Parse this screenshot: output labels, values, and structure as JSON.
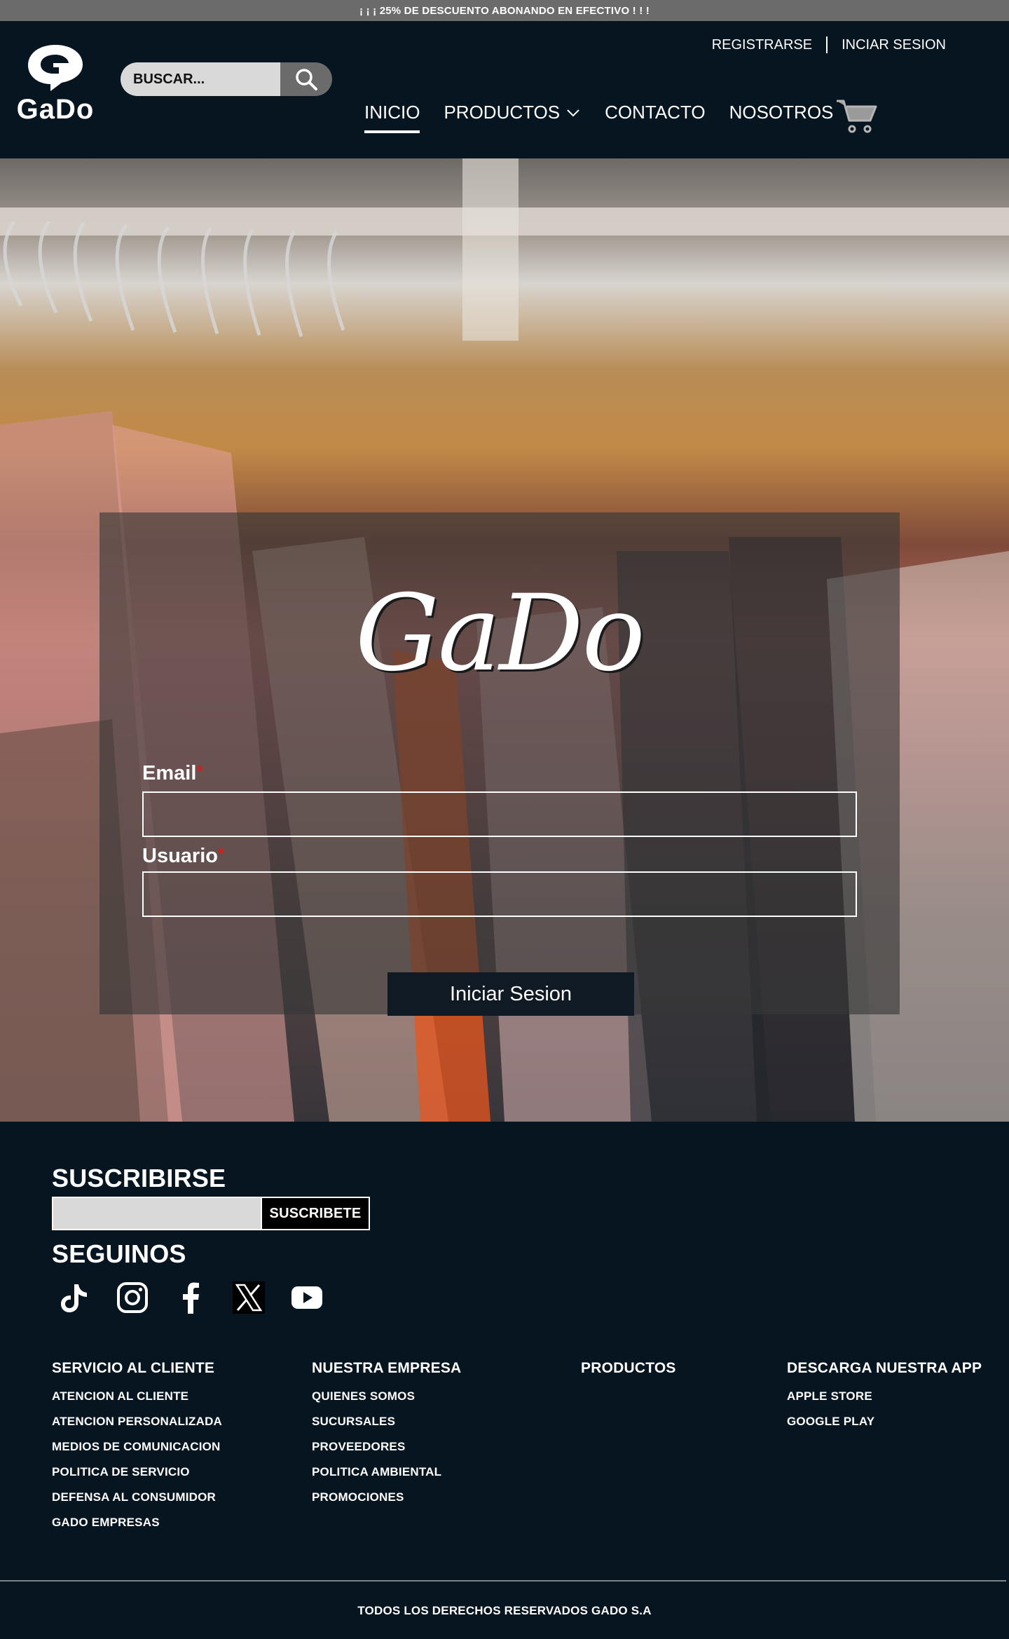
{
  "promo": {
    "text": "¡ ¡ ¡ 25% DE DESCUENTO ABONANDO EN EFECTIVO ! ! !"
  },
  "header": {
    "logo_text": "GaDo",
    "search": {
      "placeholder": "BUSCAR..."
    },
    "account": {
      "register": "REGISTRARSE",
      "login": "INCIAR SESION"
    },
    "nav": {
      "inicio": "INICIO",
      "productos": "PRODUCTOS",
      "contacto": "CONTACTO",
      "nosotros": "NOSOTROS"
    }
  },
  "login": {
    "brand": "GaDo",
    "email_label": "Email",
    "usuario_label": "Usuario",
    "required_mark": "*",
    "submit": "Iniciar Sesion"
  },
  "footer": {
    "subscribe_title": "SUSCRIBIRSE",
    "subscribe_button": "SUSCRIBETE",
    "follow_title": "SEGUINOS",
    "socials": [
      "tiktok-icon",
      "instagram-icon",
      "facebook-icon",
      "x-icon",
      "youtube-icon"
    ],
    "columns": [
      {
        "title": "SERVICIO AL CLIENTE",
        "links": [
          "ATENCION AL CLIENTE",
          "ATENCION PERSONALIZADA",
          "MEDIOS DE COMUNICACION",
          "POLITICA DE SERVICIO",
          "DEFENSA AL CONSUMIDOR",
          "GADO EMPRESAS"
        ]
      },
      {
        "title": "NUESTRA EMPRESA",
        "links": [
          "QUIENES SOMOS",
          "SUCURSALES",
          "PROVEEDORES",
          "POLITICA AMBIENTAL",
          "PROMOCIONES"
        ]
      },
      {
        "title": "PRODUCTOS",
        "links": []
      },
      {
        "title": "DESCARGA NUESTRA APP",
        "links": [
          "APPLE STORE",
          "GOOGLE PLAY"
        ]
      }
    ],
    "copyright": "TODOS LOS DERECHOS RESERVADOS GADO S.A"
  },
  "colors": {
    "background": "#061520",
    "promo_bar": "#6b6b6b",
    "required": "#d0201a",
    "button": "#0f1a24"
  }
}
